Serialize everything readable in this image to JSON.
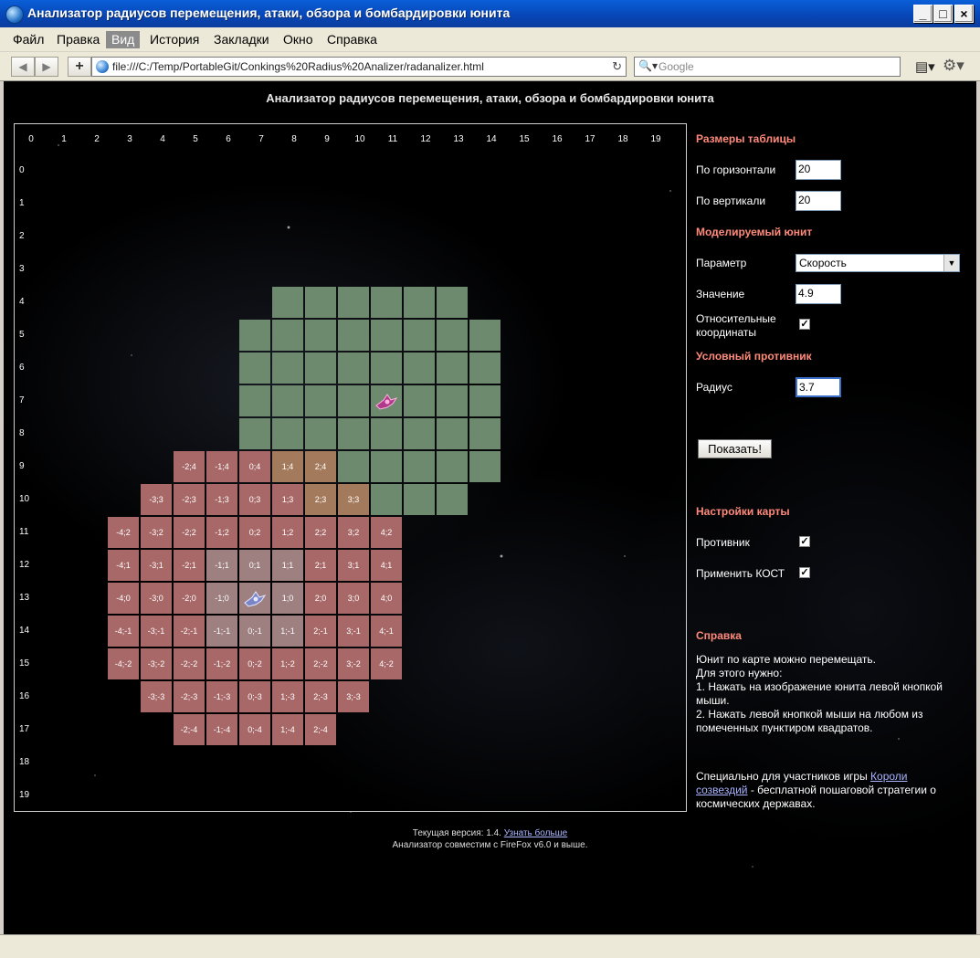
{
  "window": {
    "title": "Анализатор радиусов перемещения, атаки, обзора и бомбардировки юнита"
  },
  "menu": [
    "Файл",
    "Правка",
    "Вид",
    "История",
    "Закладки",
    "Окно",
    "Справка"
  ],
  "address": {
    "url": "file:///C:/Temp/PortableGit/Conkings%20Radius%20Analizer/radanalizer.html"
  },
  "search": {
    "placeholder": "Google"
  },
  "page": {
    "heading": "Анализатор радиусов перемещения, атаки, обзора и бомбардировки юнита",
    "col_labels": [
      "0",
      "1",
      "2",
      "3",
      "4",
      "5",
      "6",
      "7",
      "8",
      "9",
      "10",
      "11",
      "12",
      "13",
      "14",
      "15",
      "16",
      "17",
      "18",
      "19"
    ],
    "row_labels": [
      "0",
      "1",
      "2",
      "3",
      "4",
      "5",
      "6",
      "7",
      "8",
      "9",
      "10",
      "11",
      "12",
      "13",
      "14",
      "15",
      "16",
      "17",
      "18",
      "19"
    ],
    "grid": {
      "green": [
        [
          4,
          8
        ],
        [
          4,
          13
        ],
        [
          5,
          7
        ],
        [
          5,
          14
        ],
        [
          6,
          7
        ],
        [
          6,
          14
        ],
        [
          7,
          7
        ],
        [
          7,
          14
        ],
        [
          8,
          7
        ],
        [
          8,
          14
        ],
        [
          9,
          10
        ],
        [
          9,
          14
        ],
        [
          10,
          11
        ],
        [
          10,
          13
        ]
      ],
      "red": [
        [
          9,
          5,
          "-2;4",
          "red"
        ],
        [
          9,
          6,
          "-1;4",
          "red"
        ],
        [
          9,
          7,
          "0;4",
          "red"
        ],
        [
          9,
          8,
          "1;4",
          "tan"
        ],
        [
          9,
          9,
          "2;4",
          "tan"
        ],
        [
          10,
          4,
          "-3;3",
          "red"
        ],
        [
          10,
          5,
          "-2;3",
          "red"
        ],
        [
          10,
          6,
          "-1;3",
          "red"
        ],
        [
          10,
          7,
          "0;3",
          "red"
        ],
        [
          10,
          8,
          "1;3",
          "red"
        ],
        [
          10,
          9,
          "2;3",
          "tan"
        ],
        [
          10,
          10,
          "3;3",
          "tan"
        ],
        [
          11,
          3,
          "-4;2",
          "red"
        ],
        [
          11,
          4,
          "-3;2",
          "red"
        ],
        [
          11,
          5,
          "-2;2",
          "red"
        ],
        [
          11,
          6,
          "-1;2",
          "red"
        ],
        [
          11,
          7,
          "0;2",
          "red"
        ],
        [
          11,
          8,
          "1;2",
          "red"
        ],
        [
          11,
          9,
          "2;2",
          "red"
        ],
        [
          11,
          10,
          "3;2",
          "red"
        ],
        [
          11,
          11,
          "4;2",
          "red"
        ],
        [
          12,
          3,
          "-4;1",
          "red"
        ],
        [
          12,
          4,
          "-3;1",
          "red"
        ],
        [
          12,
          5,
          "-2;1",
          "red"
        ],
        [
          12,
          6,
          "-1;1",
          "pale"
        ],
        [
          12,
          7,
          "0;1",
          "pale"
        ],
        [
          12,
          8,
          "1;1",
          "pale"
        ],
        [
          12,
          9,
          "2;1",
          "red"
        ],
        [
          12,
          10,
          "3;1",
          "red"
        ],
        [
          12,
          11,
          "4;1",
          "red"
        ],
        [
          13,
          3,
          "-4;0",
          "red"
        ],
        [
          13,
          4,
          "-3;0",
          "red"
        ],
        [
          13,
          5,
          "-2;0",
          "red"
        ],
        [
          13,
          6,
          "-1;0",
          "pale"
        ],
        [
          13,
          7,
          "",
          "pale"
        ],
        [
          13,
          8,
          "1;0",
          "pale"
        ],
        [
          13,
          9,
          "2;0",
          "red"
        ],
        [
          13,
          10,
          "3;0",
          "red"
        ],
        [
          13,
          11,
          "4;0",
          "red"
        ],
        [
          14,
          3,
          "-4;-1",
          "red"
        ],
        [
          14,
          4,
          "-3;-1",
          "red"
        ],
        [
          14,
          5,
          "-2;-1",
          "red"
        ],
        [
          14,
          6,
          "-1;-1",
          "pale"
        ],
        [
          14,
          7,
          "0;-1",
          "pale"
        ],
        [
          14,
          8,
          "1;-1",
          "pale"
        ],
        [
          14,
          9,
          "2;-1",
          "red"
        ],
        [
          14,
          10,
          "3;-1",
          "red"
        ],
        [
          14,
          11,
          "4;-1",
          "red"
        ],
        [
          15,
          3,
          "-4;-2",
          "red"
        ],
        [
          15,
          4,
          "-3;-2",
          "red"
        ],
        [
          15,
          5,
          "-2;-2",
          "red"
        ],
        [
          15,
          6,
          "-1;-2",
          "red"
        ],
        [
          15,
          7,
          "0;-2",
          "red"
        ],
        [
          15,
          8,
          "1;-2",
          "red"
        ],
        [
          15,
          9,
          "2;-2",
          "red"
        ],
        [
          15,
          10,
          "3;-2",
          "red"
        ],
        [
          15,
          11,
          "4;-2",
          "red"
        ],
        [
          16,
          4,
          "-3;-3",
          "red"
        ],
        [
          16,
          5,
          "-2;-3",
          "red"
        ],
        [
          16,
          6,
          "-1;-3",
          "red"
        ],
        [
          16,
          7,
          "0;-3",
          "red"
        ],
        [
          16,
          8,
          "1;-3",
          "red"
        ],
        [
          16,
          9,
          "2;-3",
          "red"
        ],
        [
          16,
          10,
          "3;-3",
          "red"
        ],
        [
          17,
          5,
          "-2;-4",
          "red"
        ],
        [
          17,
          6,
          "-1;-4",
          "red"
        ],
        [
          17,
          7,
          "0;-4",
          "red"
        ],
        [
          17,
          8,
          "1;-4",
          "red"
        ],
        [
          17,
          9,
          "2;-4",
          "red"
        ]
      ],
      "enemy_cell": [
        7,
        11
      ],
      "unit_cell": [
        13,
        7
      ]
    },
    "settings": {
      "table_heading": "Размеры таблицы",
      "horiz_label": "По горизонтали",
      "horiz_value": "20",
      "vert_label": "По вертикали",
      "vert_value": "20",
      "unit_heading": "Моделируемый юнит",
      "param_label": "Параметр",
      "param_value": "Скорость",
      "value_label": "Значение",
      "value_value": "4.9",
      "relative_label_1": "Относительные",
      "relative_label_2": "координаты",
      "relative_checked": true,
      "enemy_heading": "Условный противник",
      "radius_label": "Радиус",
      "radius_value": "3.7",
      "show_button": "Показать!",
      "map_heading": "Настройки карты",
      "enemy_label": "Противник",
      "enemy_checked": true,
      "kost_label": "Применить КОСТ",
      "kost_checked": true,
      "help_heading": "Справка",
      "help_lines": [
        "Юнит по карте можно перемещать.",
        "Для этого нужно:",
        "1. Нажать на изображение юнита левой кнопкой",
        "мыши.",
        "2. Нажать левой кнопкой мыши на любом из",
        "помеченных пунктиром квадратов."
      ],
      "special_prefix": "Специально для участников игры ",
      "special_link_1": "Короли",
      "special_link_2": "созвездий",
      "special_suffix": " - бесплатной пошаговой стратегии о",
      "special_line_3": "космических державах."
    },
    "footer": {
      "version_text": "Текущая версия: 1.4. ",
      "version_link": "Узнать больше",
      "compat_text": "Анализатор совместим с FireFox v6.0 и выше."
    }
  },
  "colors": {
    "green_cell": "#6e8a6e",
    "red_cell": "#a86868",
    "tan_cell": "#a47a5c",
    "heading": "#ff8a7a"
  }
}
